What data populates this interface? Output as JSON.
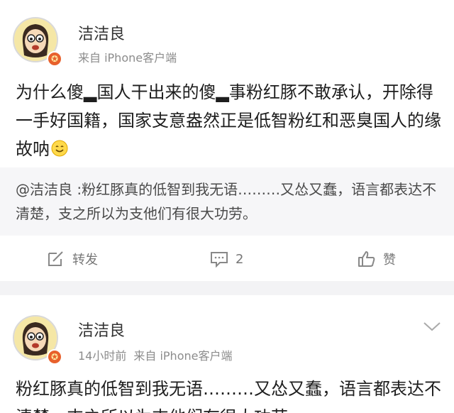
{
  "posts": [
    {
      "author": "洁洁良",
      "meta": "来自 iPhone客户端",
      "text": "为什么傻▂国人干出来的傻▂事粉红豚不敢承认，开除得一手好国籍，国家支意盎然正是低智粉红和恶臭国人的缘故呐",
      "quote": "@洁洁良 :粉红豚真的低智到我无语………又怂又蠢，语言都表达不清楚，支之所以为支他们有很大功劳。",
      "actions": {
        "repost_label": "转发",
        "comment_count": "2",
        "like_label": "赞"
      }
    },
    {
      "author": "洁洁良",
      "time": "14小时前",
      "source": "来自 iPhone客户端",
      "text": "粉红豚真的低智到我无语………又怂又蠢，语言都表达不清楚，支之所以为支他们有很大功劳。"
    }
  ],
  "colors": {
    "badge": "#e8612c",
    "divider": "#f3f3f5",
    "quote_bg": "#f6f6f8"
  },
  "icons": [
    "avatar-cartoon",
    "verified-badge",
    "repost-icon",
    "comment-icon",
    "like-icon",
    "chevron-down-icon",
    "smile-emoji"
  ]
}
